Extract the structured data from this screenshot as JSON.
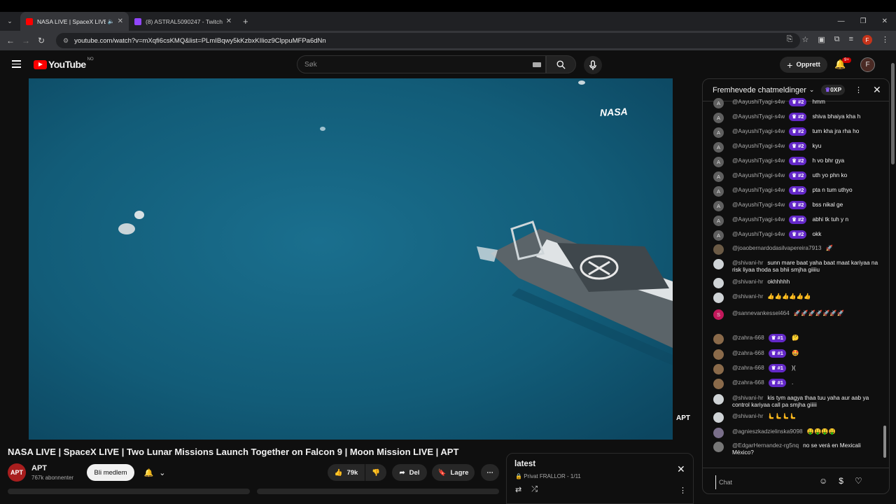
{
  "browser": {
    "tabs": [
      {
        "title": "NASA LIVE | SpaceX LIVE | T",
        "active": true,
        "favicon_color": "#ff0000"
      },
      {
        "title": "(8) ASTRAL5090247 - Twitch",
        "active": false,
        "favicon_color": "#9146ff"
      }
    ],
    "url": "youtube.com/watch?v=mXqfi6csKMQ&list=PLmIBqwy5kKzbxKIlioz9ClppuMFPa6dNn",
    "profile_initial": "F"
  },
  "youtube": {
    "logo_text": "YouTube",
    "country_code": "NO",
    "search_placeholder": "Søk",
    "create_label": "Opprett",
    "notification_count": "9+",
    "avatar_initial": "F"
  },
  "video": {
    "watermark": "NASA",
    "channel_watermark": "APT",
    "title": "NASA LIVE | SpaceX LIVE | Two Lunar Missions Launch Together on Falcon 9 | Moon Mission LIVE | APT"
  },
  "channel": {
    "avatar_text": "APT",
    "name": "APT",
    "subscribers": "767k abonnenter",
    "join_label": "Bli medlem"
  },
  "actions": {
    "likes": "79k",
    "share_label": "Del",
    "save_label": "Lagre"
  },
  "playlist": {
    "title": "latest",
    "privacy": "Privat",
    "owner_position": "FRALLOR - 1/11"
  },
  "chat": {
    "header_title": "Fremhevede chatmeldinger",
    "xp_label": "0XP",
    "input_placeholder": "Chat",
    "messages": [
      {
        "author": "@AayushiTyagi-s4w",
        "rank": "#2",
        "text": "hmm",
        "avatar": "A",
        "avatar_color": "#5f5f5f"
      },
      {
        "author": "@AayushiTyagi-s4w",
        "rank": "#2",
        "text": "shiva bhaiya kha h",
        "avatar": "A",
        "avatar_color": "#5f5f5f"
      },
      {
        "author": "@AayushiTyagi-s4w",
        "rank": "#2",
        "text": "tum kha jra rha ho",
        "avatar": "A",
        "avatar_color": "#5f5f5f"
      },
      {
        "author": "@AayushiTyagi-s4w",
        "rank": "#2",
        "text": "kyu",
        "avatar": "A",
        "avatar_color": "#5f5f5f"
      },
      {
        "author": "@AayushiTyagi-s4w",
        "rank": "#2",
        "text": "h vo bhr gya",
        "avatar": "A",
        "avatar_color": "#5f5f5f"
      },
      {
        "author": "@AayushiTyagi-s4w",
        "rank": "#2",
        "text": "uth yo phn ko",
        "avatar": "A",
        "avatar_color": "#5f5f5f"
      },
      {
        "author": "@AayushiTyagi-s4w",
        "rank": "#2",
        "text": "pta n tum uthyo",
        "avatar": "A",
        "avatar_color": "#5f5f5f"
      },
      {
        "author": "@AayushiTyagi-s4w",
        "rank": "#2",
        "text": "bss nikal ge",
        "avatar": "A",
        "avatar_color": "#5f5f5f"
      },
      {
        "author": "@AayushiTyagi-s4w",
        "rank": "#2",
        "text": "abhi tk tuh y n",
        "avatar": "A",
        "avatar_color": "#5f5f5f"
      },
      {
        "author": "@AayushiTyagi-s4w",
        "rank": "#2",
        "text": "okk",
        "avatar": "A",
        "avatar_color": "#5f5f5f"
      },
      {
        "author": "@joaobernardodasilvapereira7913",
        "rank": "",
        "text": "🚀",
        "avatar": "",
        "avatar_color": "#6b5a45"
      },
      {
        "author": "@shivani-hr",
        "rank": "",
        "text": "sunn mare baat yaha baat maat kariyaa na risk liyaa thoda sa bhii smjha giiiiu",
        "avatar": "",
        "avatar_color": "#cfd3d6"
      },
      {
        "author": "@shivani-hr",
        "rank": "",
        "text": "okhhhhh",
        "avatar": "",
        "avatar_color": "#cfd3d6"
      },
      {
        "author": "@shivani-hr",
        "rank": "",
        "text": "👍👍👍👍👍👍",
        "avatar": "",
        "avatar_color": "#cfd3d6"
      },
      {
        "author": "@sannevankessel464",
        "rank": "",
        "text": "🚀🚀🚀🚀🚀🚀🚀",
        "avatar": "S",
        "avatar_color": "#c2185b"
      },
      {
        "author": "@zahra-668",
        "rank": "#1",
        "text": "🤔",
        "avatar": "",
        "avatar_color": "#8a6a4a"
      },
      {
        "author": "@zahra-668",
        "rank": "#1",
        "text": "🤩",
        "avatar": "",
        "avatar_color": "#8a6a4a"
      },
      {
        "author": "@zahra-668",
        "rank": "#1",
        "text": ")(",
        "avatar": "",
        "avatar_color": "#8a6a4a"
      },
      {
        "author": "@zahra-668",
        "rank": "#1",
        "text": ".",
        "avatar": "",
        "avatar_color": "#8a6a4a"
      },
      {
        "author": "@shivani-hr",
        "rank": "",
        "text": "kis tym aagya thaa tuu yaha aur aab ya control kariyaa call pa smjha giiiii",
        "avatar": "",
        "avatar_color": "#cfd3d6"
      },
      {
        "author": "@shivani-hr",
        "rank": "",
        "text": "🫷🫷🫷🫷",
        "avatar": "",
        "avatar_color": "#cfd3d6"
      },
      {
        "author": "@agnieszkadzielinska9098",
        "rank": "",
        "text": "🤑🤑🤑🤑",
        "avatar": "",
        "avatar_color": "#7a6f8a"
      },
      {
        "author": "@EdgarHernandez-rg5nq",
        "rank": "",
        "text": "no se verá en Mexicali México?",
        "avatar": "",
        "avatar_color": "#777777"
      }
    ]
  }
}
